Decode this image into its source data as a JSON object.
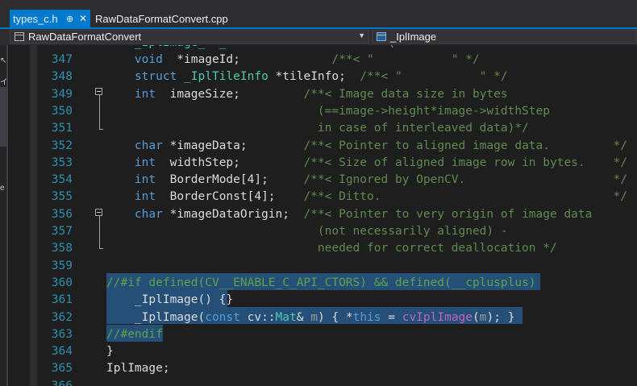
{
  "tabs": [
    {
      "label": "types_c.h",
      "pin_icon": "pin-icon",
      "close_icon": "close-icon",
      "active": true
    },
    {
      "label": "RawDataFormatConvert.cpp",
      "active": false
    }
  ],
  "nav": {
    "scope": "RawDataFormatConvert",
    "member": "_IplImage"
  },
  "left_pane_chars": [
    "↖",
    "イ",
    "e"
  ],
  "code_lines": [
    {
      "n": "347",
      "text": "    void  *imageId;             /**< \"           \" */"
    },
    {
      "n": "348",
      "text": "    struct _IplTileInfo *tileInfo;  /**< \"           \" */"
    },
    {
      "n": "349",
      "text": "    int  imageSize;         /**< Image data size in bytes"
    },
    {
      "n": "350",
      "text": "                              (==image->height*image->widthStep"
    },
    {
      "n": "351",
      "text": "                              in case of interleaved data)*/"
    },
    {
      "n": "352",
      "text": "    char *imageData;        /**< Pointer to aligned image data.         */"
    },
    {
      "n": "353",
      "text": "    int  widthStep;         /**< Size of aligned image row in bytes.    */"
    },
    {
      "n": "354",
      "text": "    int  BorderMode[4];     /**< Ignored by OpenCV.                     */"
    },
    {
      "n": "355",
      "text": "    int  BorderConst[4];    /**< Ditto.                                 */"
    },
    {
      "n": "356",
      "text": "    char *imageDataOrigin;  /**< Pointer to very origin of image data"
    },
    {
      "n": "357",
      "text": "                              (not necessarily aligned) -"
    },
    {
      "n": "358",
      "text": "                              needed for correct deallocation */"
    },
    {
      "n": "359",
      "text": ""
    },
    {
      "n": "360",
      "text": "//#if defined(CV__ENABLE_C_API_CTORS) && defined(__cplusplus)"
    },
    {
      "n": "361",
      "text": "    _IplImage() {}"
    },
    {
      "n": "362",
      "text": "    _IplImage(const cv::Mat& m) { *this = cvIplImage(m); }"
    },
    {
      "n": "363",
      "text": "//#endif"
    },
    {
      "n": "364",
      "text": "}"
    },
    {
      "n": "365",
      "text": "IplImage;"
    },
    {
      "n": "366",
      "text": ""
    }
  ],
  "partial_top_line": "    _IplImage_  _                       (         ",
  "colors": {
    "accent": "#007acc",
    "line_number": "#2b91af",
    "keyword": "#569cd6",
    "comment": "#57a64a",
    "type": "#4ec9b0",
    "selection": "#264f78"
  }
}
